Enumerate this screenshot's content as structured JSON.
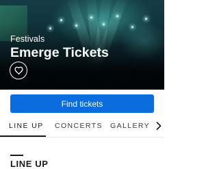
{
  "hero": {
    "category": "Festivals",
    "title": "Emerge Tickets",
    "favorite_icon": "heart-outline-icon"
  },
  "cta": {
    "label": "Find tickets",
    "color": "#0b6cde"
  },
  "tabs": {
    "items": [
      {
        "label": "LINE UP",
        "active": true
      },
      {
        "label": "CONCERTS",
        "active": false
      },
      {
        "label": "GALLERY",
        "active": false
      }
    ],
    "next_icon": "chevron-right-icon"
  },
  "section": {
    "title": "LINE UP"
  }
}
